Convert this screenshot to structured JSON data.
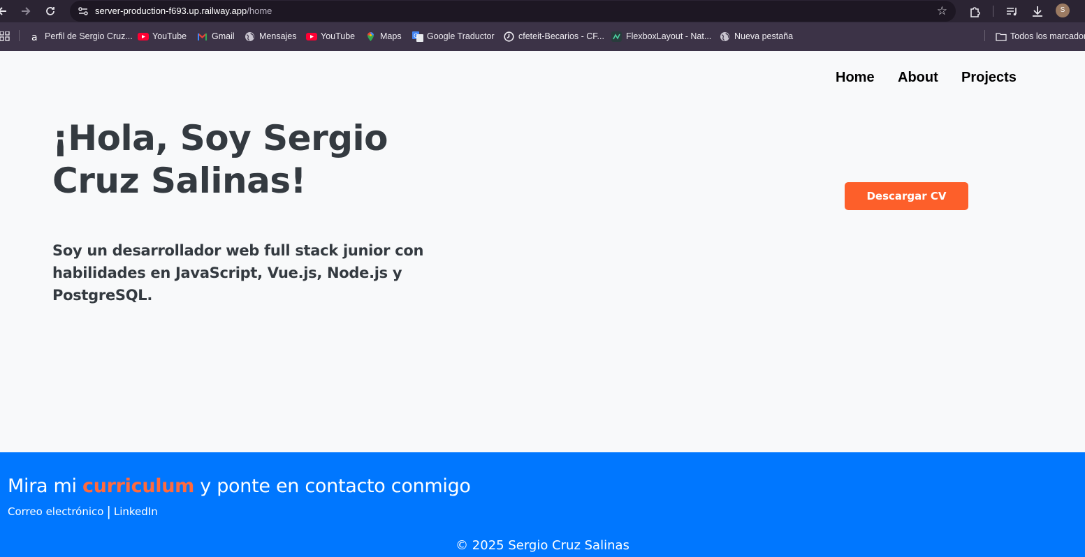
{
  "browser": {
    "url_host": "server-production-f693.up.railway.app",
    "url_path": "/home",
    "profile_initial": "S",
    "bookmarks": [
      {
        "label": "Perfil de Sergio Cruz...",
        "icon": "a-letter-icon"
      },
      {
        "label": "YouTube",
        "icon": "youtube-icon"
      },
      {
        "label": "Gmail",
        "icon": "gmail-icon"
      },
      {
        "label": "Mensajes",
        "icon": "globe-icon"
      },
      {
        "label": "YouTube",
        "icon": "youtube-icon"
      },
      {
        "label": "Maps",
        "icon": "maps-icon"
      },
      {
        "label": "Google Traductor",
        "icon": "translate-icon"
      },
      {
        "label": "cfeteit-Becarios - CF...",
        "icon": "clock-icon"
      },
      {
        "label": "FlexboxLayout - Nat...",
        "icon": "flexbox-icon"
      },
      {
        "label": "Nueva pestaña",
        "icon": "globe-icon"
      }
    ],
    "all_bookmarks_label": "Todos los marcadores"
  },
  "nav": {
    "home": "Home",
    "about": "About",
    "projects": "Projects"
  },
  "hero": {
    "title": "¡Hola, Soy Sergio Cruz Salinas!",
    "subtitle": "Soy un desarrollador web full stack junior con habilidades en JavaScript, Vue.js, Node.js y PostgreSQL.",
    "cv_button": "Descargar CV"
  },
  "footer": {
    "heading_pre": "Mira mi ",
    "heading_highlight": "curriculum",
    "heading_post": " y ponte en contacto conmigo",
    "email_link": "Correo electrónico",
    "separator": "|",
    "linkedin_link": "LinkedIn",
    "copyright": "© 2025 Sergio Cruz Salinas"
  },
  "colors": {
    "accent_orange": "#fd5f2a",
    "footer_blue": "#0077ff",
    "text_dark": "#343a40",
    "page_bg": "#f8f9fa"
  }
}
